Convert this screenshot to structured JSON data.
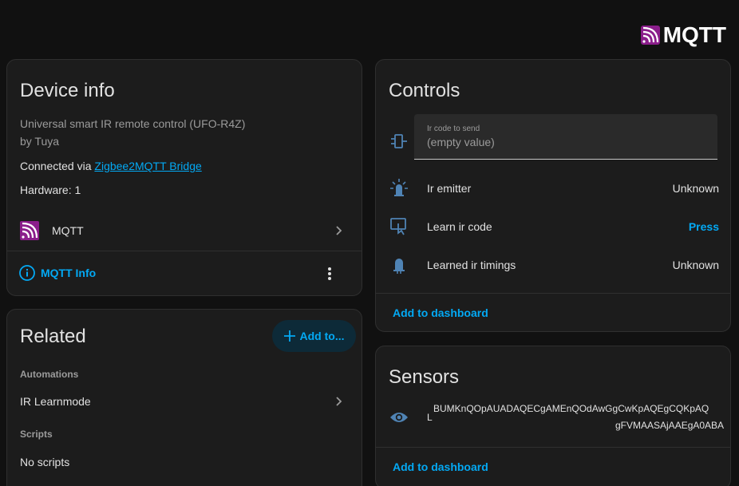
{
  "brand": {
    "text": "MQTT",
    "icon": "mqtt-logo-icon",
    "accent": "#8b1e8b"
  },
  "device_info": {
    "title": "Device info",
    "model": "Universal smart IR remote control (UFO-R4Z)",
    "by": "by Tuya",
    "connected_prefix": "Connected via ",
    "connected_link": "Zigbee2MQTT Bridge",
    "hardware": "Hardware: 1",
    "integration_label": "MQTT",
    "mqtt_info_label": "MQTT Info"
  },
  "related": {
    "title": "Related",
    "add_button": "Add to...",
    "automations_heading": "Automations",
    "automation_item": "IR Learnmode",
    "scripts_heading": "Scripts",
    "scripts_value": "No scripts"
  },
  "controls": {
    "title": "Controls",
    "ir_code_field": {
      "label": "Ir code to send",
      "value": "(empty value)"
    },
    "rows": [
      {
        "label": "Ir emitter",
        "value": "Unknown"
      },
      {
        "label": "Learn ir code",
        "value": "Press"
      },
      {
        "label": "Learned ir timings",
        "value": "Unknown"
      }
    ],
    "add_to_dashboard": "Add to dashboard"
  },
  "sensors": {
    "title": "Sensors",
    "row_prefix": "L",
    "value_line1": "BUMKnQOpAUADAQECgAMEnQOdAwGgCwKpAQEgCQKpAQ",
    "value_line2": "gFVMAASAjAAEgA0ABA",
    "add_to_dashboard": "Add to dashboard"
  },
  "colors": {
    "background": "#111111",
    "card": "#1c1c1c",
    "accent_blue": "#03a9f4",
    "icon_blue": "#4f83b4",
    "mqtt_purple": "#8b1e8b"
  }
}
